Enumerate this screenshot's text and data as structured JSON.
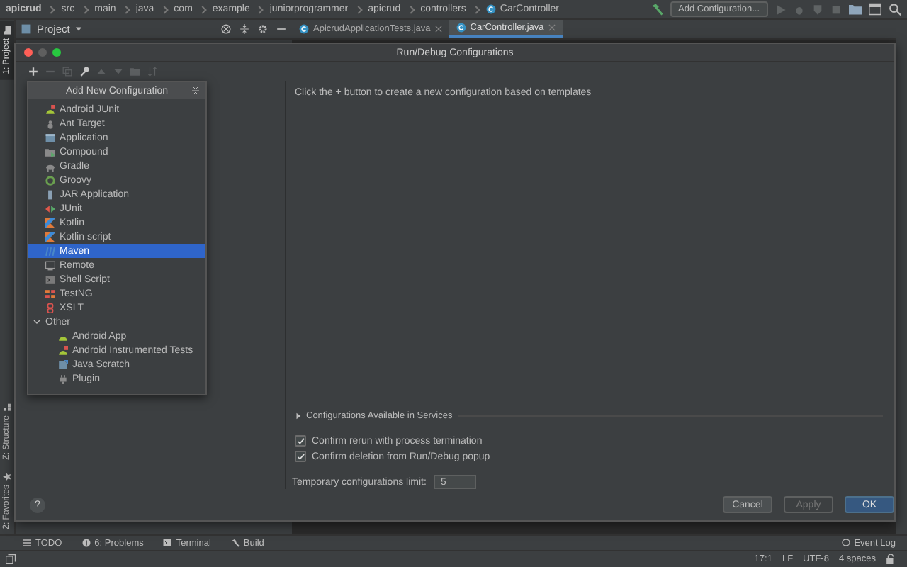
{
  "breadcrumbs": [
    {
      "label": "apicrud",
      "kind": "project"
    },
    {
      "label": "src",
      "kind": "folder"
    },
    {
      "label": "main",
      "kind": "folder"
    },
    {
      "label": "java",
      "kind": "folder"
    },
    {
      "label": "com",
      "kind": "folder"
    },
    {
      "label": "example",
      "kind": "folder"
    },
    {
      "label": "juniorprogrammer",
      "kind": "folder"
    },
    {
      "label": "apicrud",
      "kind": "folder"
    },
    {
      "label": "controllers",
      "kind": "folder"
    },
    {
      "label": "CarController",
      "kind": "class"
    }
  ],
  "main_toolbar": {
    "run_config": "Add Configuration..."
  },
  "side_tabs": [
    {
      "label": "1: Project",
      "kind": "project",
      "selected": true
    },
    {
      "label": "Z: Structure",
      "kind": "structure",
      "selected": false
    },
    {
      "label": "2: Favorites",
      "kind": "favorites",
      "selected": false
    }
  ],
  "project_panel": {
    "title": "Project"
  },
  "editor_tabs": [
    {
      "label": "ApicrudApplicationTests.java",
      "selected": false
    },
    {
      "label": "CarController.java",
      "selected": true
    }
  ],
  "dialog": {
    "title": "Run/Debug Configurations",
    "toolbar": [
      {
        "kind": "add",
        "disabled": false
      },
      {
        "kind": "remove",
        "disabled": true
      },
      {
        "kind": "copy",
        "disabled": true
      },
      {
        "kind": "edit",
        "disabled": false
      },
      {
        "kind": "up",
        "disabled": true
      },
      {
        "kind": "down",
        "disabled": true
      },
      {
        "kind": "folder",
        "disabled": true
      },
      {
        "kind": "sort",
        "disabled": true
      }
    ],
    "popup": {
      "title": "Add New Configuration",
      "items": [
        {
          "label": "Android JUnit",
          "kind": "android-test",
          "selected": false
        },
        {
          "label": "Ant Target",
          "kind": "ant",
          "selected": false
        },
        {
          "label": "Application",
          "kind": "app",
          "selected": false
        },
        {
          "label": "Compound",
          "kind": "compound",
          "selected": false
        },
        {
          "label": "Gradle",
          "kind": "gradle",
          "selected": false
        },
        {
          "label": "Groovy",
          "kind": "groovy",
          "selected": false
        },
        {
          "label": "JAR Application",
          "kind": "jar",
          "selected": false
        },
        {
          "label": "JUnit",
          "kind": "junit",
          "selected": false
        },
        {
          "label": "Kotlin",
          "kind": "kotlin",
          "selected": false
        },
        {
          "label": "Kotlin script",
          "kind": "kotlin",
          "selected": false
        },
        {
          "label": "Maven",
          "kind": "maven",
          "selected": true
        },
        {
          "label": "Remote",
          "kind": "remote",
          "selected": false
        },
        {
          "label": "Shell Script",
          "kind": "shell",
          "selected": false
        },
        {
          "label": "TestNG",
          "kind": "testng",
          "selected": false
        },
        {
          "label": "XSLT",
          "kind": "xslt",
          "selected": false
        },
        {
          "label": "Other",
          "kind": "group",
          "expanded": true,
          "selected": false,
          "children": [
            {
              "label": "Android App",
              "kind": "android",
              "selected": false
            },
            {
              "label": "Android Instrumented Tests",
              "kind": "android-test",
              "selected": false
            },
            {
              "label": "Java Scratch",
              "kind": "scratch",
              "selected": false
            },
            {
              "label": "Plugin",
              "kind": "plugin",
              "selected": false
            }
          ]
        }
      ]
    },
    "hint": "Click the **+** button to create a new configuration based on templates",
    "services": {
      "label": "Configurations Available in Services",
      "expanded": false
    },
    "options": [
      {
        "label": "Confirm rerun with process termination",
        "checked": true
      },
      {
        "label": "Confirm deletion from Run/Debug popup",
        "checked": true
      }
    ],
    "limit": {
      "label": "Temporary configurations limit:",
      "value": "5"
    },
    "help": "?",
    "buttons": [
      {
        "label": "Cancel",
        "kind": "normal",
        "disabled": false
      },
      {
        "label": "Apply",
        "kind": "normal",
        "disabled": true
      },
      {
        "label": "OK",
        "kind": "default",
        "disabled": false
      }
    ]
  },
  "tool_windows": [
    {
      "label": "TODO",
      "kind": "list"
    },
    {
      "label": "6: Problems",
      "kind": "problems"
    },
    {
      "label": "Terminal",
      "kind": "terminal"
    },
    {
      "label": "Build",
      "kind": "build"
    }
  ],
  "event_log": "Event Log",
  "status": [
    "17:1",
    "LF",
    "UTF-8",
    "4 spaces"
  ]
}
